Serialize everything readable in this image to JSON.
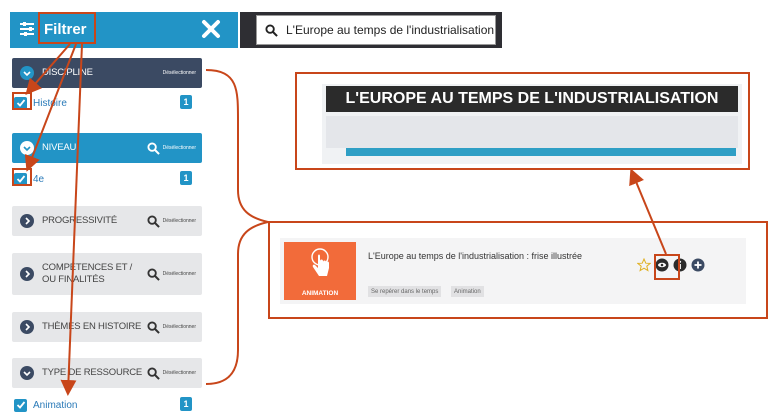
{
  "header": {
    "filter_label": "Filtrer"
  },
  "search": {
    "value": "L'Europe au temps de l'industrialisation"
  },
  "facets": [
    {
      "label": "DISCIPLINE",
      "clear": "Désélectionner"
    },
    {
      "label": "NIVEAU",
      "clear": "Désélectionner"
    },
    {
      "label": "PROGRESSIVITÉ",
      "clear": "Désélectionner"
    },
    {
      "label": "COMPÉTENCES ET / OU FINALITÉS",
      "clear": "Désélectionner"
    },
    {
      "label": "THÈMES EN HISTOIRE",
      "clear": "Désélectionner"
    },
    {
      "label": "TYPE DE RESSOURCE",
      "clear": "Désélectionner"
    }
  ],
  "selections": [
    {
      "label": "Histoire",
      "count": "1"
    },
    {
      "label": "4e",
      "count": "1"
    },
    {
      "label": "Animation",
      "count": "1"
    }
  ],
  "preview": {
    "title": "L'EUROPE AU TEMPS DE L'INDUSTRIALISATION"
  },
  "result": {
    "title": "L'Europe au temps de l'industrialisation : frise illustrée",
    "thumb_label": "ANIMATION",
    "tags": [
      "Se repérer dans le temps",
      "Animation"
    ]
  },
  "colors": {
    "accent": "#2294c6",
    "dark": "#3b4a63",
    "annotation": "#c8461a",
    "thumb": "#f26b3a"
  }
}
